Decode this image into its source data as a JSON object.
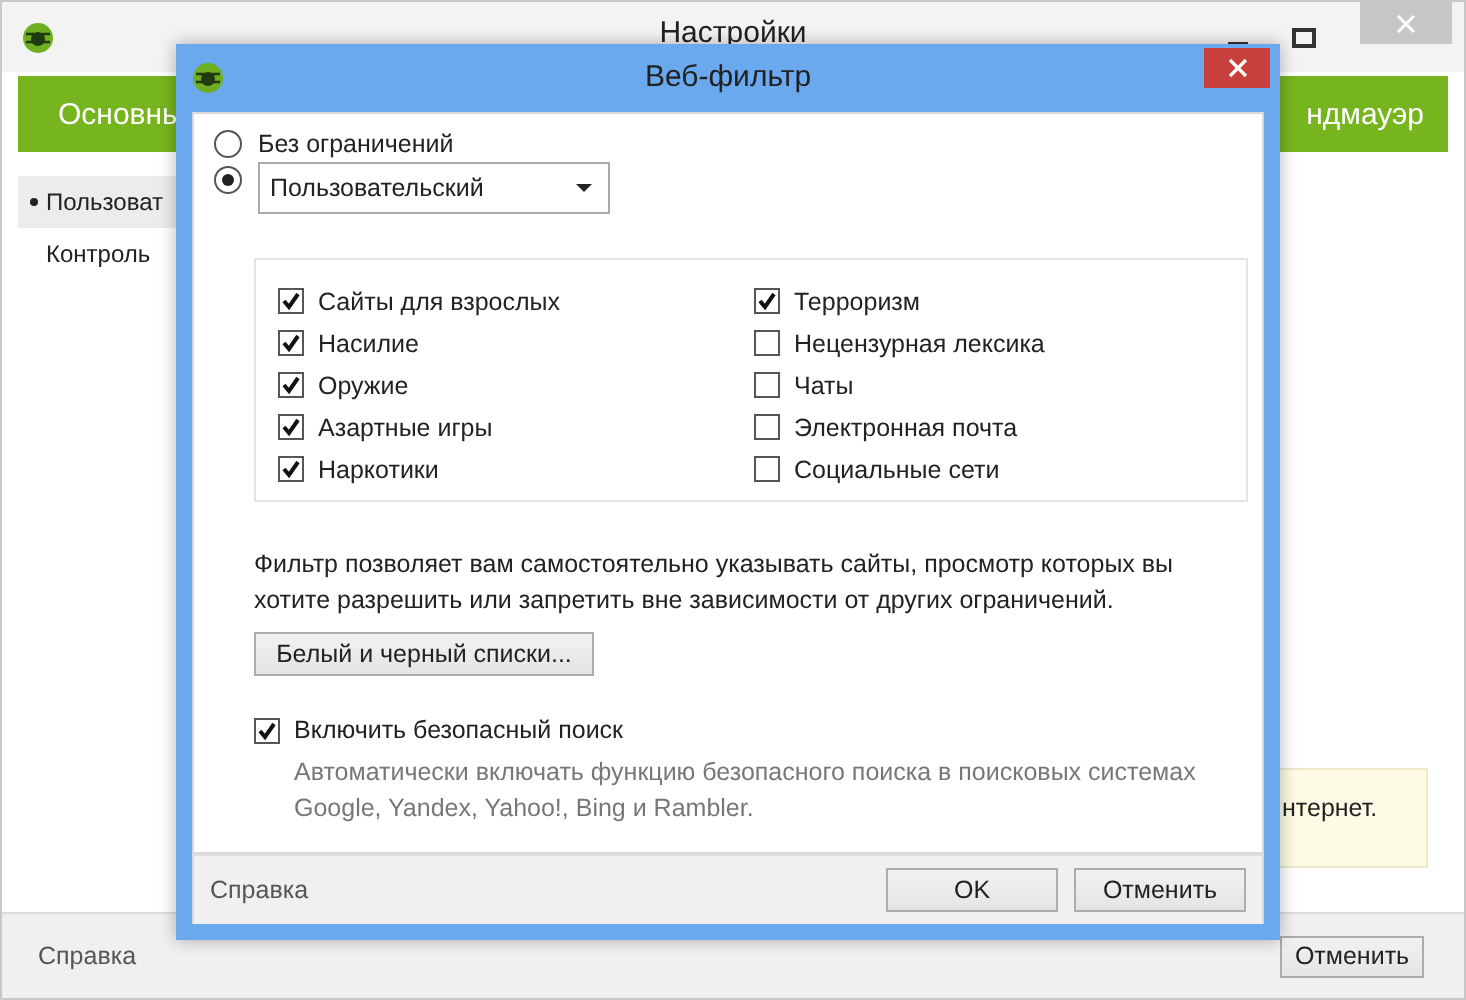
{
  "window": {
    "title": "Настройки"
  },
  "tabs": [
    {
      "label": "Основны"
    },
    {
      "label": "ндмауэр"
    }
  ],
  "sidebar": {
    "items": [
      {
        "label": "Пользоват",
        "selected": true
      },
      {
        "label": "Контроль",
        "selected": false
      }
    ]
  },
  "note": {
    "text": "нтернет."
  },
  "footer": {
    "help": "Справка",
    "buttons": [
      "Отменить"
    ]
  },
  "dialog": {
    "title": "Веб-фильтр",
    "modes": [
      {
        "kind": "label",
        "label": "Без ограничений",
        "selected": false
      },
      {
        "kind": "dropdown",
        "value": "Пользовательский",
        "selected": true
      }
    ],
    "categories": [
      {
        "label": "Сайты для взрослых",
        "checked": true
      },
      {
        "label": "Насилие",
        "checked": true
      },
      {
        "label": "Оружие",
        "checked": true
      },
      {
        "label": "Азартные игры",
        "checked": true
      },
      {
        "label": "Наркотики",
        "checked": true
      },
      {
        "label": "Терроризм",
        "checked": true
      },
      {
        "label": "Нецензурная лексика",
        "checked": false
      },
      {
        "label": "Чаты",
        "checked": false
      },
      {
        "label": "Электронная почта",
        "checked": false
      },
      {
        "label": "Социальные сети",
        "checked": false
      }
    ],
    "description": "Фильтр позволяет вам самостоятельно указывать сайты, просмотр которых вы хотите разрешить или запретить вне зависимости от других ограничений.",
    "list_button": "Белый и черный списки...",
    "safe_search": {
      "label": "Включить безопасный поиск",
      "checked": true,
      "description": "Автоматически включать функцию безопасного поиска в поисковых системах Google, Yandex, Yahoo!, Bing и Rambler."
    },
    "help": "Справка",
    "buttons": [
      "OK",
      "Отменить"
    ]
  }
}
